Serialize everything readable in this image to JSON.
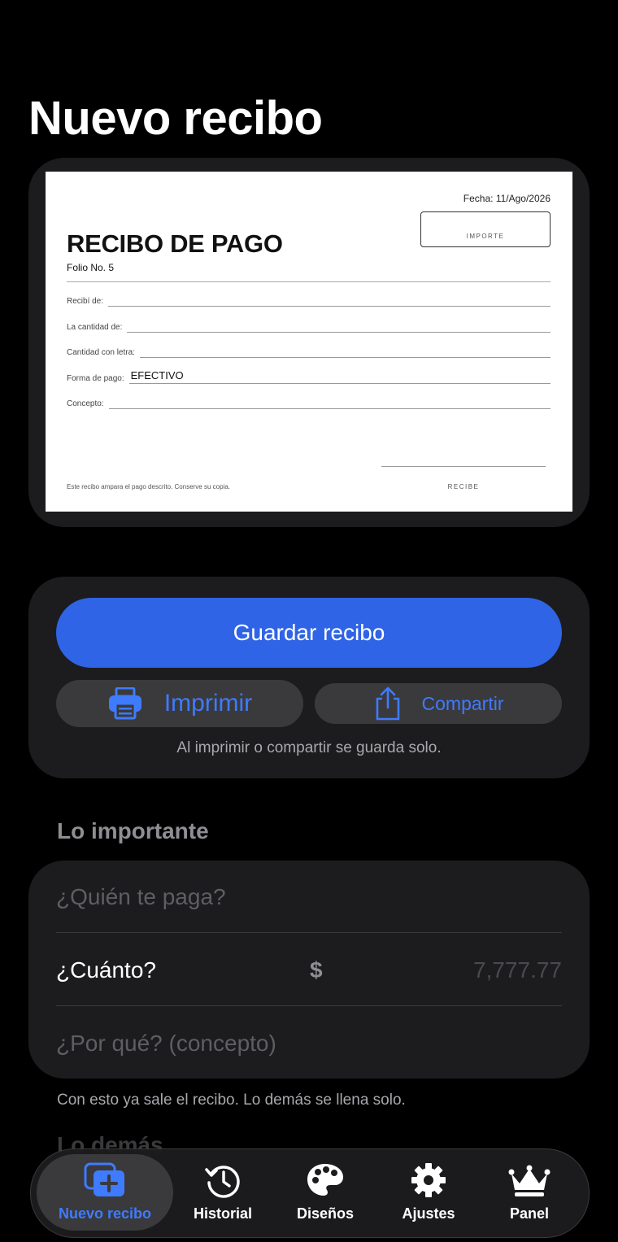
{
  "page": {
    "title": "Nuevo recibo"
  },
  "receipt": {
    "date": "Fecha: 11/Ago/2026",
    "importe_label": "IMPORTE",
    "title": "RECIBO DE PAGO",
    "folio": "Folio No. 5",
    "fields": [
      {
        "label": "Recibí de:",
        "value": ""
      },
      {
        "label": "La cantidad de:",
        "value": ""
      },
      {
        "label": "Cantidad con letra:",
        "value": ""
      },
      {
        "label": "Forma de pago:",
        "value": "EFECTIVO"
      },
      {
        "label": "Concepto:",
        "value": ""
      }
    ],
    "footer_note": "Este recibo ampara el pago descrito. Conserve su copia.",
    "signature_label": "RECIBE"
  },
  "actions": {
    "save_label": "Guardar recibo",
    "print_label": "Imprimir",
    "share_label": "Compartir",
    "hint": "Al imprimir o compartir se guarda solo."
  },
  "important": {
    "section_title": "Lo importante",
    "payer_placeholder": "¿Quién te paga?",
    "amount_label": "¿Cuánto?",
    "currency_symbol": "$",
    "amount_placeholder": "7,777.77",
    "concept_placeholder": "¿Por qué? (concepto)",
    "note": "Con esto ya sale el recibo. Lo demás se llena solo."
  },
  "others": {
    "section_title": "Lo demás"
  },
  "tabbar": {
    "items": [
      {
        "label": "Nuevo recibo",
        "icon": "new-receipt-icon",
        "active": true
      },
      {
        "label": "Historial",
        "icon": "history-icon",
        "active": false
      },
      {
        "label": "Diseños",
        "icon": "palette-icon",
        "active": false
      },
      {
        "label": "Ajustes",
        "icon": "gear-icon",
        "active": false
      },
      {
        "label": "Panel",
        "icon": "crown-icon",
        "active": false
      }
    ]
  },
  "colors": {
    "accent": "#2f64e6",
    "accent_text": "#3f7bff",
    "card": "#1c1c1e",
    "background": "#000000"
  }
}
